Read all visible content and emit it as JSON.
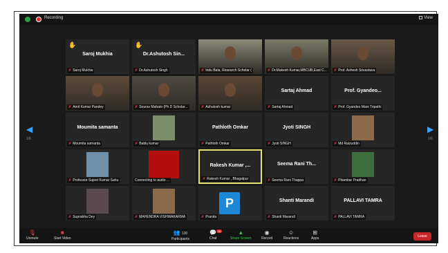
{
  "topbar": {
    "recording": "Recording",
    "view": "View"
  },
  "nav": {
    "left_page": "1/6",
    "right_page": "1/6"
  },
  "tiles": [
    {
      "name": "Saroj Mukhia",
      "label": "Saroj Mukhia",
      "hand": true
    },
    {
      "name": "Dr.Ashutosh  Sin...",
      "label": "Dr.Ashutosh Singh",
      "hand": true
    },
    {
      "name": "",
      "label": "Indu Bala, Research Scholar ("
    },
    {
      "name": "",
      "label": "Dr.Mukesh Kumar,MBCUB,East C..."
    },
    {
      "name": "",
      "label": "Prof. Ashesh Srivastava"
    },
    {
      "name": "",
      "label": "Amit Kumar Pandey"
    },
    {
      "name": "",
      "label": "Sourav Mahato (Ph.D Scholar..."
    },
    {
      "name": "",
      "label": "Ashutosh kumar"
    },
    {
      "name": "Sartaj Ahmad",
      "label": "Sartaj Ahmad"
    },
    {
      "name": "Prof. Gyandeo...",
      "label": "Prof. Gyandeo Mani Tripathi"
    },
    {
      "name": "Moumita samanta",
      "label": "Moumita samanta"
    },
    {
      "name": "",
      "label": "Bablu kumar"
    },
    {
      "name": "Pathloth Omkar",
      "label": "Pathloth Omkar"
    },
    {
      "name": "Jyoti SINGH",
      "label": "Jyoti SINGH"
    },
    {
      "name": "",
      "label": "Md Raizuddin"
    },
    {
      "name": "",
      "label": "Professor Sujeet Kumar Sahu"
    },
    {
      "name": "",
      "label": "Connecting to audio ..."
    },
    {
      "name": "Rakesh Kumar ,...",
      "label": "Rakesh Kumar , Bhagalpur"
    },
    {
      "name": "Seema  Rani Th...",
      "label": "Seema  Rani Thappa"
    },
    {
      "name": "",
      "label": "Pitambar Pradhan"
    },
    {
      "name": "",
      "label": "Suprabha Dey"
    },
    {
      "name": "",
      "label": "MAHENDRA VISHWAKARMA"
    },
    {
      "name": "P",
      "label": "Pranita"
    },
    {
      "name": "Shanti Marandi",
      "label": "Shanti Marandi"
    },
    {
      "name": "PALLAVI TAMRA",
      "label": "PALLAVI TAMRA"
    }
  ],
  "controls": {
    "unmute": "Unmute",
    "start_video": "Start Video",
    "participants": "Participants",
    "participants_count": "130",
    "chat": "Chat",
    "chat_badge": "10",
    "share_screen": "Share Screen",
    "record": "Record",
    "reactions": "Reactions",
    "apps": "Apps",
    "leave": "Leave"
  }
}
